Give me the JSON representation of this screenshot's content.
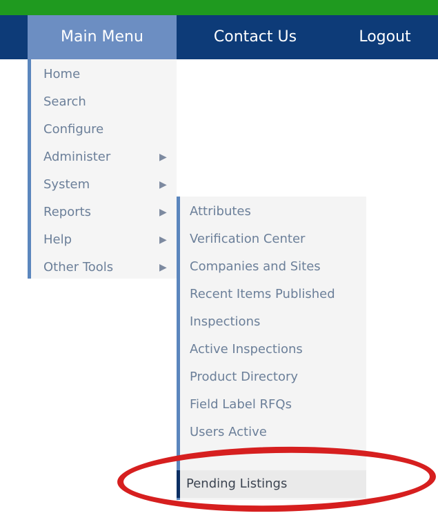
{
  "nav": {
    "main_menu": "Main Menu",
    "contact_us": "Contact Us",
    "logout": "Logout"
  },
  "menu": {
    "items": [
      {
        "label": "Home",
        "has_submenu": false
      },
      {
        "label": "Search",
        "has_submenu": false
      },
      {
        "label": "Configure",
        "has_submenu": false
      },
      {
        "label": "Administer",
        "has_submenu": true
      },
      {
        "label": "System",
        "has_submenu": true
      },
      {
        "label": "Reports",
        "has_submenu": true
      },
      {
        "label": "Help",
        "has_submenu": true
      },
      {
        "label": "Other Tools",
        "has_submenu": true
      }
    ],
    "arrow_glyph": "▶"
  },
  "submenu": {
    "items": [
      "Attributes",
      "Verification Center",
      "Companies and Sites",
      "Recent Items Published",
      "Inspections",
      "Active Inspections",
      "Product Directory",
      "Field Label RFQs",
      "Users Active",
      "Pending Listings"
    ]
  },
  "annotation": {
    "color": "#d61f1f"
  }
}
